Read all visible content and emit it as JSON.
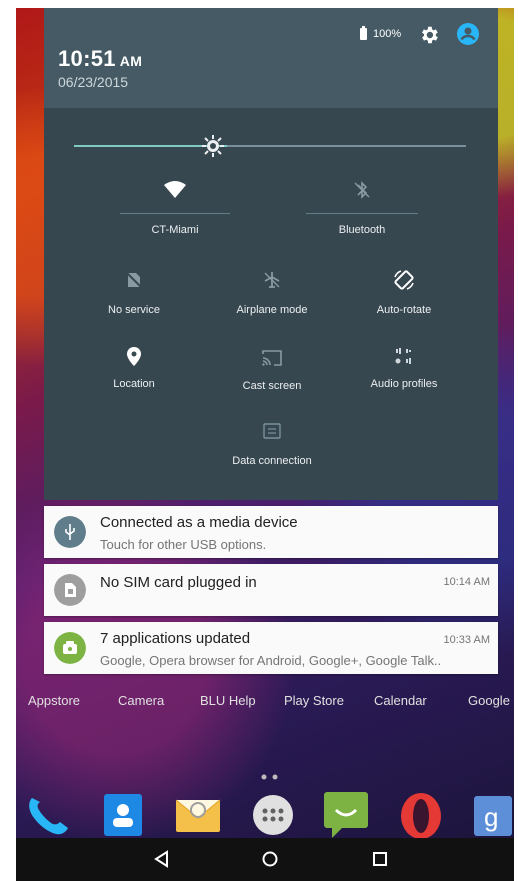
{
  "status": {
    "time": "10:51",
    "ampm": "AM",
    "date": "06/23/2015",
    "battery": "100%",
    "icons": [
      "settings-gear-icon",
      "user-avatar-icon"
    ]
  },
  "brightness": {
    "level": 0.39
  },
  "tiles": {
    "wifi": "CT-Miami",
    "bluetooth": "Bluetooth",
    "no_service": "No service",
    "airplane": "Airplane mode",
    "auto_rotate": "Auto-rotate",
    "location": "Location",
    "cast": "Cast screen",
    "audio": "Audio profiles",
    "data": "Data connection"
  },
  "notifications": [
    {
      "title": "Connected as a media device",
      "subtitle": "Touch for other USB options.",
      "time": "",
      "icon": "usb-icon",
      "color": "#607d8b"
    },
    {
      "title": "No SIM card plugged in",
      "subtitle": "",
      "time": "10:14 AM",
      "icon": "sim-card-icon",
      "color": "#9e9e9e"
    },
    {
      "title": "7 applications updated",
      "subtitle": "Google, Opera browser for Android, Google+, Google Talk..",
      "time": "10:33 AM",
      "icon": "app-update-icon",
      "color": "#7cb342"
    }
  ],
  "home_apps": [
    "Appstore",
    "Camera",
    "BLU Help",
    "Play Store",
    "Calendar",
    "Google"
  ],
  "dock": [
    "phone-icon",
    "contacts-icon",
    "email-icon",
    "app-drawer-icon",
    "messaging-icon",
    "opera-icon",
    "google-search-icon"
  ],
  "colors": {
    "accent": "#80cbc4",
    "panel": "#37474f",
    "header": "#455a64"
  }
}
